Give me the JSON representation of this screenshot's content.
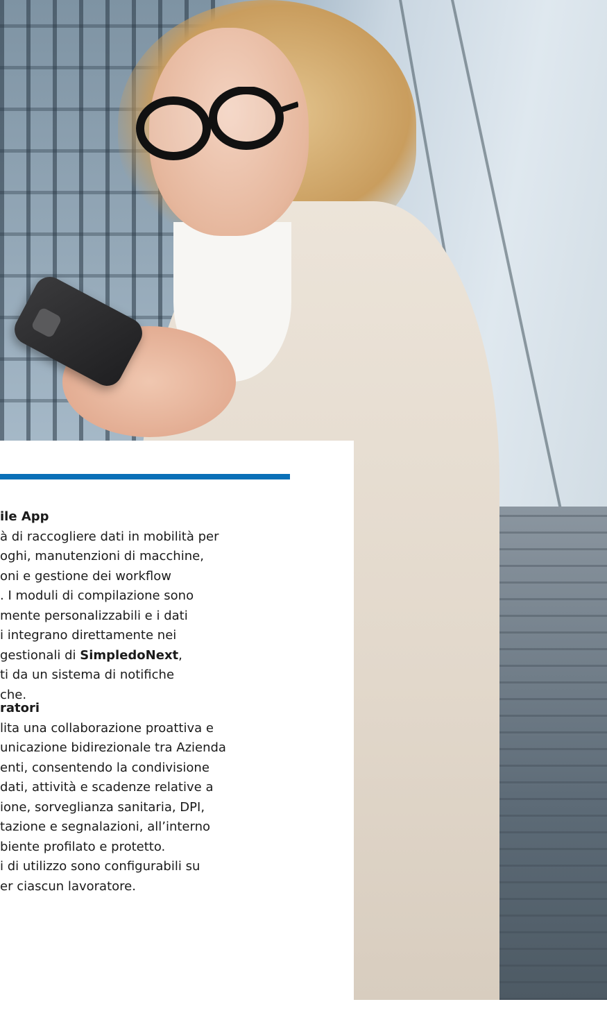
{
  "colors": {
    "accent_bar": "#0a70b8",
    "text": "#1a1a1a",
    "panel_background": "#ffffff"
  },
  "photo": {
    "description_icon": "photo-woman-smartphone"
  },
  "section_mobile_app": {
    "heading": "ile App",
    "lines": [
      "à di raccogliere dati in mobilità per",
      "oghi, manutenzioni di macchine,",
      "oni e gestione dei workflow",
      ". I moduli di compilazione sono",
      "mente personalizzabili e i dati",
      "i integrano direttamente nei",
      "gestionali di ",
      "ti da un sistema di notifiche",
      "che."
    ],
    "brand": "SimpledoNext",
    "brand_suffix": ","
  },
  "section_lavoratori": {
    "heading": "ratori",
    "lines": [
      "lita una collaborazione proattiva e",
      "unicazione bidirezionale tra Azienda",
      "enti, consentendo la condivisione",
      "dati, attività e scadenze relative a",
      "ione, sorveglianza sanitaria, DPI,",
      "tazione e segnalazioni, all’interno",
      "biente profilato e protetto.",
      "i di utilizzo sono configurabili su",
      "er ciascun lavoratore."
    ]
  }
}
